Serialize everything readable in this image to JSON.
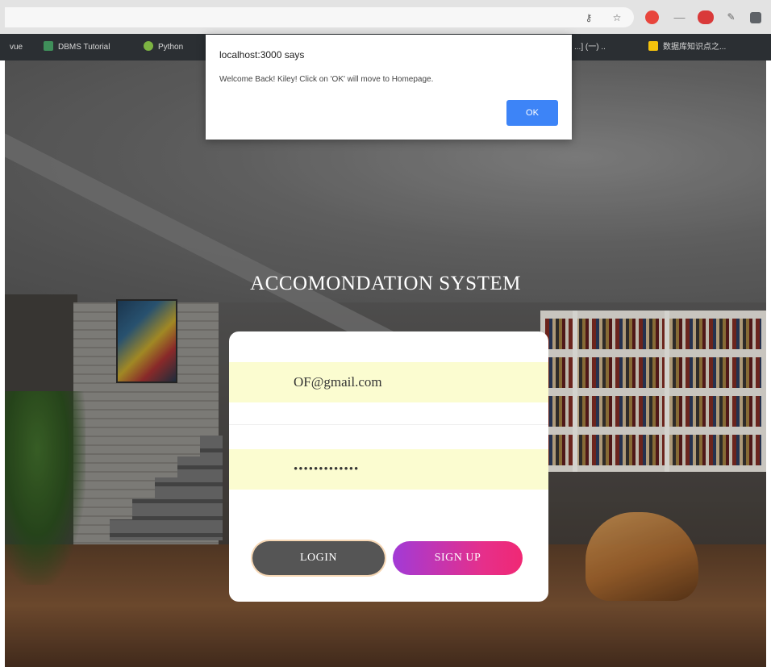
{
  "browser": {
    "address_icons": [
      "key-icon",
      "star-icon"
    ],
    "address_icon_glyphs": [
      "⚷",
      "☆"
    ],
    "extensions": [
      {
        "name": "extension-red-icon",
        "color": "#e8453c"
      },
      {
        "name": "extension-dash-icon",
        "color": "#8a8a8a"
      },
      {
        "name": "extension-pill-icon",
        "color": "#d93a3a"
      },
      {
        "name": "extension-feather-icon",
        "color": "#6a6a6a"
      },
      {
        "name": "extension-square-icon",
        "color": "#5f6368"
      }
    ],
    "bookmarks": [
      {
        "label": "vue",
        "icon_color": null
      },
      {
        "label": "DBMS Tutorial",
        "icon_color": "#3f8f5a"
      },
      {
        "label": "Python",
        "icon_color": "#7cb342"
      },
      {
        "label": "...] (一) ..",
        "icon_color": null
      },
      {
        "label": "数据库知识点之...",
        "icon_color": "#f4c20d"
      }
    ]
  },
  "dialog": {
    "title": "localhost:3000 says",
    "message": "Welcome Back! Kiley! Click on 'OK' will move to Homepage.",
    "ok_label": "OK",
    "accent_color": "#3d84f7"
  },
  "page": {
    "title": "ACCOMONDATION SYSTEM"
  },
  "login_form": {
    "email_value": "OF@gmail.com",
    "password_value": "•••••••••••••",
    "field_background": "#fbfcd0",
    "login_label": "LOGIN",
    "signup_label": "SIGN UP",
    "login_color": "#555555",
    "signup_gradient": [
      "#a23ad6",
      "#f02874"
    ]
  }
}
